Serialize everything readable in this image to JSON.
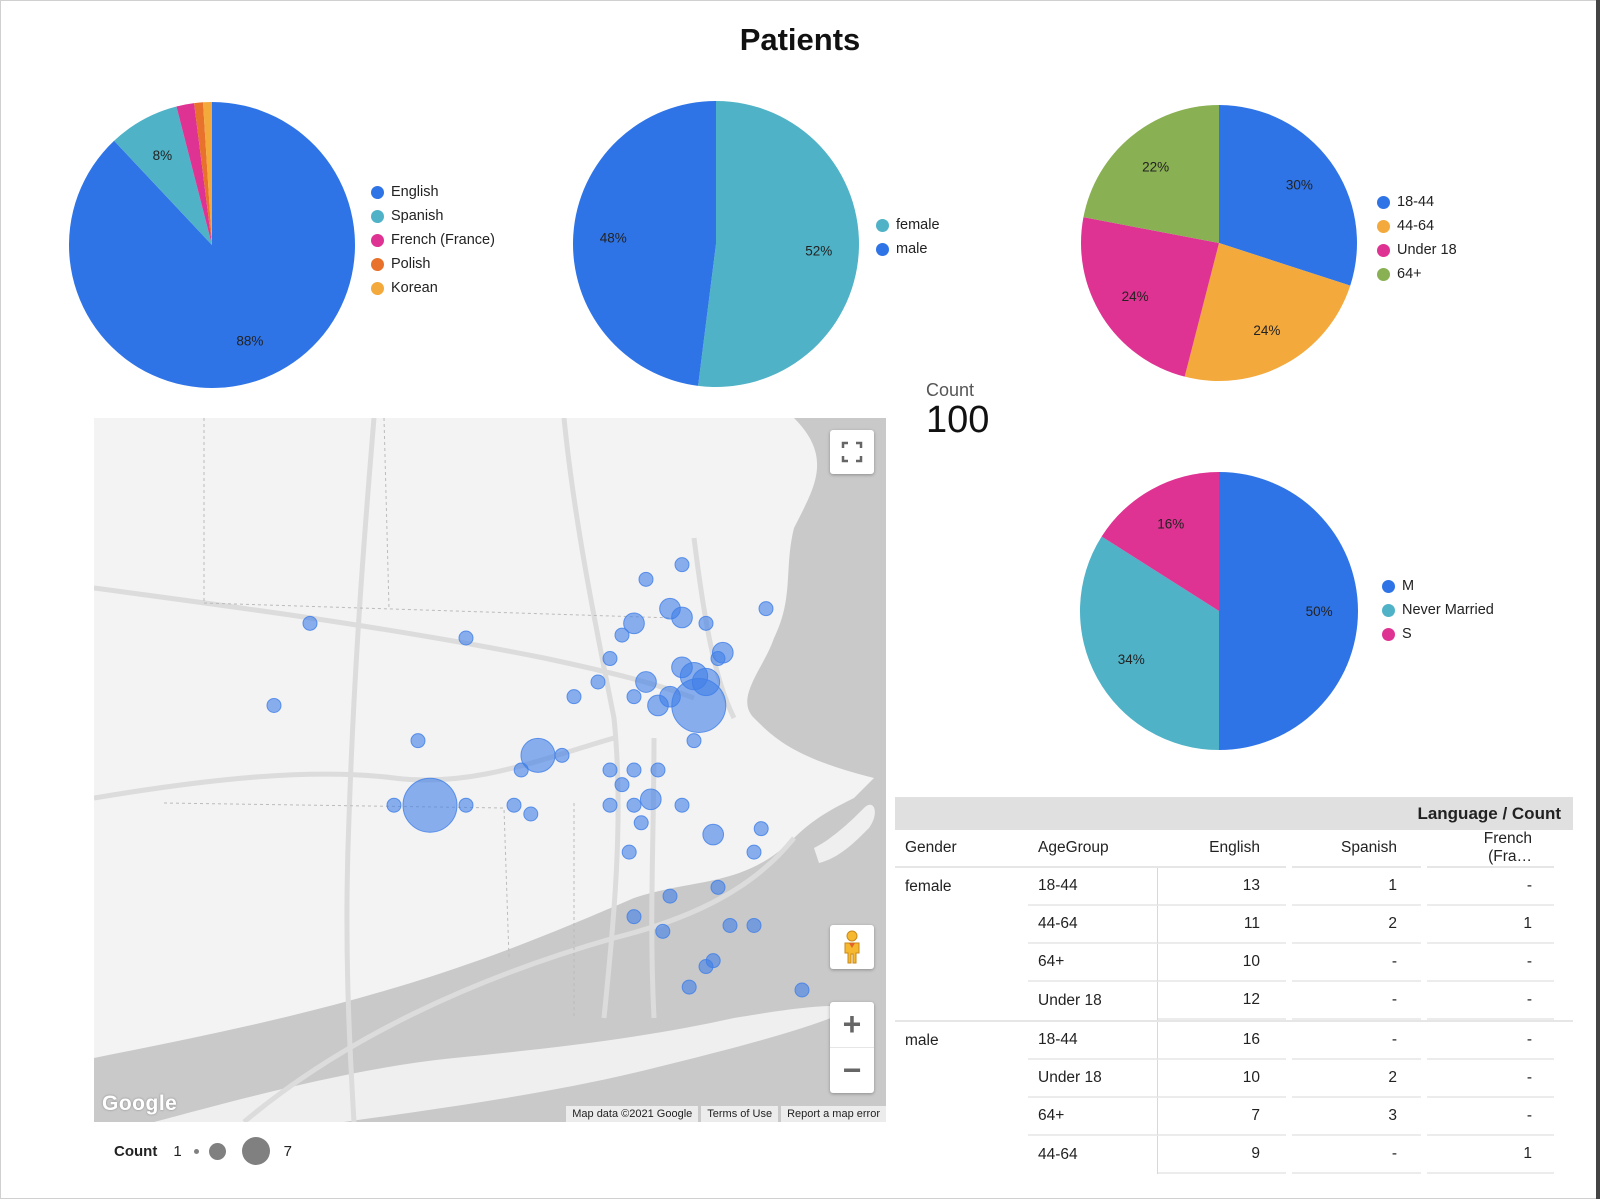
{
  "page": {
    "title": "Patients"
  },
  "chart_data": [
    {
      "type": "pie",
      "name": "language",
      "categories": [
        "English",
        "Spanish",
        "French (France)",
        "Polish",
        "Korean"
      ],
      "values": [
        88,
        8,
        2,
        1,
        1
      ],
      "colors": [
        "#2f74e6",
        "#4fb2c7",
        "#de3392",
        "#e8722c",
        "#f3a93b"
      ],
      "slice_labels": [
        "88%",
        "8%",
        "",
        "",
        ""
      ],
      "legend": "right"
    },
    {
      "type": "pie",
      "name": "gender",
      "categories": [
        "female",
        "male"
      ],
      "values": [
        52,
        48
      ],
      "colors": [
        "#4fb2c7",
        "#2f74e6"
      ],
      "slice_labels": [
        "52%",
        "48%"
      ],
      "legend": "right"
    },
    {
      "type": "pie",
      "name": "age-group",
      "categories": [
        "18-44",
        "44-64",
        "Under 18",
        "64+"
      ],
      "values": [
        30,
        24,
        24,
        22
      ],
      "colors": [
        "#2f74e6",
        "#f3a93b",
        "#de3392",
        "#89b052"
      ],
      "slice_labels": [
        "30%",
        "24%",
        "24%",
        "22%"
      ],
      "legend": "right"
    },
    {
      "type": "pie",
      "name": "marital-status",
      "categories": [
        "M",
        "Never Married",
        "S"
      ],
      "values": [
        50,
        34,
        16
      ],
      "colors": [
        "#2f74e6",
        "#4fb2c7",
        "#de3392"
      ],
      "slice_labels": [
        "50%",
        "34%",
        "16%"
      ],
      "legend": "right"
    },
    {
      "type": "table",
      "name": "pivot-table",
      "banner": "Language / Count",
      "columns": [
        "Gender",
        "AgeGroup",
        "English",
        "Spanish",
        "French (Fra…"
      ],
      "groups": [
        {
          "gender": "female",
          "rows": [
            {
              "age": "18-44",
              "values": [
                "13",
                "1",
                "-"
              ]
            },
            {
              "age": "44-64",
              "values": [
                "11",
                "2",
                "1"
              ]
            },
            {
              "age": "64+",
              "values": [
                "10",
                "-",
                "-"
              ]
            },
            {
              "age": "Under 18",
              "values": [
                "12",
                "-",
                "-"
              ]
            }
          ]
        },
        {
          "gender": "male",
          "rows": [
            {
              "age": "18-44",
              "values": [
                "16",
                "-",
                "-"
              ]
            },
            {
              "age": "Under 18",
              "values": [
                "10",
                "2",
                "-"
              ]
            },
            {
              "age": "64+",
              "values": [
                "7",
                "3",
                "-"
              ]
            },
            {
              "age": "44-64",
              "values": [
                "9",
                "-",
                "1"
              ]
            }
          ]
        }
      ]
    }
  ],
  "scorecard": {
    "label": "Count",
    "value": "100"
  },
  "map": {
    "google_logo": "Google",
    "footer": [
      "Map data ©2021 Google",
      "Terms of Use",
      "Report a map error"
    ],
    "controls": {
      "fullscreen": "fullscreen-icon",
      "pegman": "pegman-icon",
      "zoom_in": "+",
      "zoom_out": "−"
    },
    "bubble_color": "#3f7ee8",
    "size_legend": {
      "label": "Count",
      "min": "1",
      "max": "7"
    },
    "bubbles": [
      {
        "lon": -72.6,
        "lat": 42.5,
        "count": 1
      },
      {
        "lon": -71.95,
        "lat": 42.45,
        "count": 1
      },
      {
        "lon": -72.75,
        "lat": 42.22,
        "count": 1
      },
      {
        "lon": -72.15,
        "lat": 42.1,
        "count": 1
      },
      {
        "lon": -72.1,
        "lat": 41.88,
        "count": 7
      },
      {
        "lon": -72.25,
        "lat": 41.88,
        "count": 1
      },
      {
        "lon": -71.95,
        "lat": 41.88,
        "count": 1
      },
      {
        "lon": -71.2,
        "lat": 42.65,
        "count": 1
      },
      {
        "lon": -71.05,
        "lat": 42.7,
        "count": 1
      },
      {
        "lon": -71.1,
        "lat": 42.55,
        "count": 2
      },
      {
        "lon": -71.05,
        "lat": 42.52,
        "count": 2
      },
      {
        "lon": -71.25,
        "lat": 42.5,
        "count": 2
      },
      {
        "lon": -71.3,
        "lat": 42.46,
        "count": 1
      },
      {
        "lon": -70.95,
        "lat": 42.5,
        "count": 1
      },
      {
        "lon": -70.7,
        "lat": 42.55,
        "count": 1
      },
      {
        "lon": -70.9,
        "lat": 42.38,
        "count": 1
      },
      {
        "lon": -70.88,
        "lat": 42.4,
        "count": 2
      },
      {
        "lon": -71.35,
        "lat": 42.38,
        "count": 1
      },
      {
        "lon": -71.2,
        "lat": 42.3,
        "count": 2
      },
      {
        "lon": -71.05,
        "lat": 42.35,
        "count": 2
      },
      {
        "lon": -71.1,
        "lat": 42.25,
        "count": 2
      },
      {
        "lon": -70.98,
        "lat": 42.22,
        "count": 7
      },
      {
        "lon": -71.0,
        "lat": 42.32,
        "count": 3
      },
      {
        "lon": -70.95,
        "lat": 42.3,
        "count": 3
      },
      {
        "lon": -71.15,
        "lat": 42.22,
        "count": 2
      },
      {
        "lon": -71.25,
        "lat": 42.25,
        "count": 1
      },
      {
        "lon": -71.4,
        "lat": 42.3,
        "count": 1
      },
      {
        "lon": -71.5,
        "lat": 42.25,
        "count": 1
      },
      {
        "lon": -71.65,
        "lat": 42.05,
        "count": 4
      },
      {
        "lon": -71.72,
        "lat": 42.0,
        "count": 1
      },
      {
        "lon": -71.55,
        "lat": 42.05,
        "count": 1
      },
      {
        "lon": -71.35,
        "lat": 42.0,
        "count": 1
      },
      {
        "lon": -71.25,
        "lat": 42.0,
        "count": 1
      },
      {
        "lon": -71.15,
        "lat": 42.0,
        "count": 1
      },
      {
        "lon": -71.0,
        "lat": 42.1,
        "count": 1
      },
      {
        "lon": -71.3,
        "lat": 41.95,
        "count": 1
      },
      {
        "lon": -71.18,
        "lat": 41.9,
        "count": 2
      },
      {
        "lon": -71.25,
        "lat": 41.88,
        "count": 1
      },
      {
        "lon": -71.35,
        "lat": 41.88,
        "count": 1
      },
      {
        "lon": -71.75,
        "lat": 41.88,
        "count": 1
      },
      {
        "lon": -71.68,
        "lat": 41.85,
        "count": 1
      },
      {
        "lon": -71.05,
        "lat": 41.88,
        "count": 1
      },
      {
        "lon": -71.22,
        "lat": 41.82,
        "count": 1
      },
      {
        "lon": -70.92,
        "lat": 41.78,
        "count": 2
      },
      {
        "lon": -70.72,
        "lat": 41.8,
        "count": 1
      },
      {
        "lon": -70.75,
        "lat": 41.72,
        "count": 1
      },
      {
        "lon": -71.27,
        "lat": 41.72,
        "count": 1
      },
      {
        "lon": -70.9,
        "lat": 41.6,
        "count": 1
      },
      {
        "lon": -71.1,
        "lat": 41.57,
        "count": 1
      },
      {
        "lon": -71.25,
        "lat": 41.5,
        "count": 1
      },
      {
        "lon": -71.13,
        "lat": 41.45,
        "count": 1
      },
      {
        "lon": -70.85,
        "lat": 41.47,
        "count": 1
      },
      {
        "lon": -70.75,
        "lat": 41.47,
        "count": 1
      },
      {
        "lon": -70.95,
        "lat": 41.33,
        "count": 1
      },
      {
        "lon": -70.92,
        "lat": 41.35,
        "count": 1
      },
      {
        "lon": -71.02,
        "lat": 41.26,
        "count": 1
      },
      {
        "lon": -70.55,
        "lat": 41.25,
        "count": 1
      }
    ]
  }
}
